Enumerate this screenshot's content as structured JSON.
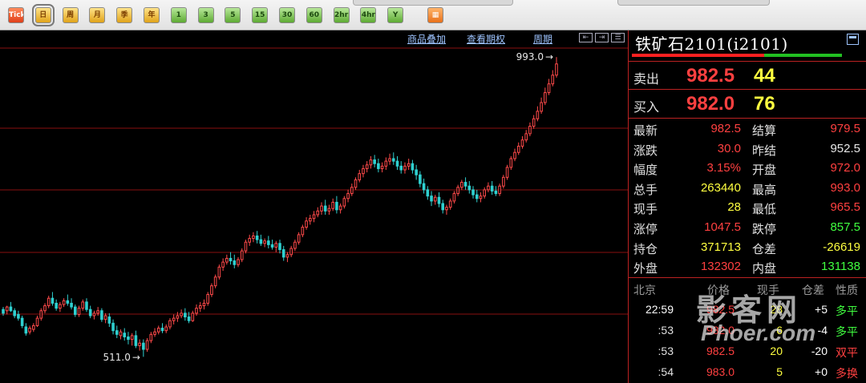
{
  "toolbar": {
    "buttons": [
      {
        "name": "tick",
        "label": "Tick",
        "color": "red"
      },
      {
        "name": "day",
        "label": "日",
        "color": "yellow",
        "selected": true
      },
      {
        "name": "week",
        "label": "周",
        "color": "yellow"
      },
      {
        "name": "month",
        "label": "月",
        "color": "yellow"
      },
      {
        "name": "season",
        "label": "季",
        "color": "yellow"
      },
      {
        "name": "year",
        "label": "年",
        "color": "yellow"
      },
      {
        "name": "min1",
        "label": "1",
        "color": "green"
      },
      {
        "name": "min3",
        "label": "3",
        "color": "green"
      },
      {
        "name": "min5",
        "label": "5",
        "color": "green"
      },
      {
        "name": "min15",
        "label": "15",
        "color": "green"
      },
      {
        "name": "min30",
        "label": "30",
        "color": "green"
      },
      {
        "name": "min60",
        "label": "60",
        "color": "green"
      },
      {
        "name": "hour2",
        "label": "2hr",
        "color": "green"
      },
      {
        "name": "hour4",
        "label": "4hr",
        "color": "green"
      },
      {
        "name": "custom",
        "label": "Y",
        "color": "green"
      },
      {
        "name": "grid",
        "label": "▦",
        "color": "orange"
      }
    ]
  },
  "chart_header": {
    "overlay_link": "商品叠加",
    "options_link": "查看期权",
    "period_link": "周期"
  },
  "chart_annotations": {
    "high_label": "993.0",
    "low_label": "511.0"
  },
  "colors": {
    "up": "#ff4a4a",
    "down": "#2fd0d0",
    "grid": "#8a1010",
    "accent_red": "#ff4040",
    "accent_yellow": "#ffff40",
    "accent_green": "#40ff40"
  },
  "chart_data": {
    "type": "candlestick",
    "high_marker": 993.0,
    "low_marker": 511.0,
    "ylim": [
      470,
      1010
    ],
    "candles": [
      [
        588,
        592,
        582,
        578
      ],
      [
        586,
        594,
        592,
        580
      ],
      [
        592,
        600,
        586,
        584
      ],
      [
        586,
        590,
        578,
        574
      ],
      [
        580,
        586,
        574,
        570
      ],
      [
        574,
        578,
        562,
        558
      ],
      [
        560,
        566,
        550,
        546
      ],
      [
        552,
        562,
        558,
        548
      ],
      [
        556,
        566,
        562,
        552
      ],
      [
        562,
        578,
        574,
        560
      ],
      [
        574,
        590,
        586,
        570
      ],
      [
        586,
        598,
        594,
        582
      ],
      [
        594,
        610,
        606,
        590
      ],
      [
        606,
        616,
        598,
        594
      ],
      [
        598,
        604,
        590,
        586
      ],
      [
        590,
        600,
        596,
        584
      ],
      [
        596,
        606,
        602,
        592
      ],
      [
        602,
        612,
        598,
        594
      ],
      [
        598,
        606,
        592,
        588
      ],
      [
        592,
        596,
        580,
        576
      ],
      [
        580,
        594,
        590,
        576
      ],
      [
        590,
        604,
        600,
        586
      ],
      [
        600,
        606,
        588,
        584
      ],
      [
        588,
        594,
        578,
        574
      ],
      [
        578,
        586,
        582,
        572
      ],
      [
        582,
        592,
        586,
        578
      ],
      [
        586,
        590,
        572,
        568
      ],
      [
        572,
        582,
        578,
        566
      ],
      [
        576,
        582,
        566,
        560
      ],
      [
        566,
        572,
        554,
        548
      ],
      [
        554,
        562,
        548,
        542
      ],
      [
        546,
        556,
        552,
        540
      ],
      [
        550,
        558,
        544,
        538
      ],
      [
        544,
        552,
        540,
        532
      ],
      [
        540,
        550,
        546,
        530
      ],
      [
        546,
        554,
        530,
        526
      ],
      [
        530,
        540,
        534,
        522
      ],
      [
        534,
        540,
        524,
        512
      ],
      [
        524,
        542,
        538,
        520
      ],
      [
        538,
        552,
        548,
        534
      ],
      [
        548,
        558,
        552,
        544
      ],
      [
        552,
        562,
        558,
        548
      ],
      [
        558,
        566,
        554,
        550
      ],
      [
        554,
        564,
        560,
        550
      ],
      [
        560,
        574,
        570,
        556
      ],
      [
        570,
        580,
        574,
        564
      ],
      [
        574,
        584,
        578,
        568
      ],
      [
        578,
        588,
        582,
        574
      ],
      [
        582,
        590,
        576,
        570
      ],
      [
        576,
        584,
        570,
        566
      ],
      [
        570,
        586,
        582,
        568
      ],
      [
        582,
        596,
        590,
        578
      ],
      [
        590,
        600,
        594,
        584
      ],
      [
        594,
        604,
        598,
        588
      ],
      [
        598,
        616,
        612,
        594
      ],
      [
        612,
        630,
        626,
        608
      ],
      [
        626,
        644,
        640,
        622
      ],
      [
        640,
        660,
        656,
        636
      ],
      [
        656,
        670,
        664,
        650
      ],
      [
        664,
        676,
        670,
        660
      ],
      [
        670,
        680,
        666,
        660
      ],
      [
        666,
        676,
        660,
        654
      ],
      [
        660,
        672,
        668,
        656
      ],
      [
        668,
        686,
        682,
        664
      ],
      [
        682,
        700,
        696,
        678
      ],
      [
        696,
        708,
        702,
        690
      ],
      [
        702,
        712,
        706,
        696
      ],
      [
        706,
        714,
        700,
        694
      ],
      [
        700,
        708,
        694,
        690
      ],
      [
        694,
        702,
        698,
        688
      ],
      [
        698,
        706,
        692,
        686
      ],
      [
        692,
        700,
        688,
        684
      ],
      [
        688,
        698,
        694,
        680
      ],
      [
        694,
        700,
        684,
        678
      ],
      [
        684,
        690,
        672,
        666
      ],
      [
        672,
        680,
        676,
        664
      ],
      [
        676,
        690,
        686,
        672
      ],
      [
        686,
        700,
        696,
        682
      ],
      [
        696,
        712,
        708,
        692
      ],
      [
        708,
        724,
        720,
        704
      ],
      [
        720,
        736,
        730,
        716
      ],
      [
        730,
        740,
        734,
        724
      ],
      [
        734,
        746,
        740,
        728
      ],
      [
        740,
        752,
        746,
        736
      ],
      [
        746,
        760,
        754,
        740
      ],
      [
        754,
        764,
        746,
        740
      ],
      [
        746,
        756,
        750,
        740
      ],
      [
        750,
        766,
        760,
        746
      ],
      [
        760,
        770,
        748,
        742
      ],
      [
        748,
        758,
        754,
        742
      ],
      [
        754,
        770,
        766,
        750
      ],
      [
        766,
        780,
        774,
        760
      ],
      [
        774,
        790,
        784,
        770
      ],
      [
        784,
        800,
        796,
        780
      ],
      [
        796,
        812,
        806,
        792
      ],
      [
        806,
        820,
        814,
        800
      ],
      [
        814,
        826,
        820,
        808
      ],
      [
        820,
        834,
        828,
        814
      ],
      [
        828,
        836,
        822,
        816
      ],
      [
        822,
        830,
        814,
        808
      ],
      [
        814,
        824,
        818,
        808
      ],
      [
        818,
        832,
        826,
        812
      ],
      [
        826,
        838,
        830,
        820
      ],
      [
        830,
        840,
        826,
        820
      ],
      [
        826,
        834,
        818,
        812
      ],
      [
        818,
        826,
        812,
        806
      ],
      [
        812,
        824,
        818,
        806
      ],
      [
        818,
        830,
        822,
        812
      ],
      [
        822,
        828,
        812,
        806
      ],
      [
        812,
        820,
        804,
        796
      ],
      [
        804,
        810,
        790,
        784
      ],
      [
        790,
        798,
        780,
        774
      ],
      [
        780,
        786,
        770,
        764
      ],
      [
        770,
        778,
        762,
        754
      ],
      [
        762,
        772,
        768,
        756
      ],
      [
        768,
        776,
        758,
        752
      ],
      [
        758,
        764,
        748,
        742
      ],
      [
        748,
        756,
        752,
        740
      ],
      [
        752,
        766,
        762,
        748
      ],
      [
        762,
        778,
        774,
        758
      ],
      [
        774,
        788,
        784,
        770
      ],
      [
        784,
        796,
        792,
        780
      ],
      [
        792,
        800,
        786,
        780
      ],
      [
        786,
        794,
        780,
        774
      ],
      [
        780,
        786,
        772,
        766
      ],
      [
        772,
        780,
        766,
        760
      ],
      [
        766,
        776,
        770,
        760
      ],
      [
        770,
        784,
        780,
        766
      ],
      [
        780,
        792,
        786,
        776
      ],
      [
        786,
        794,
        778,
        772
      ],
      [
        778,
        786,
        774,
        770
      ],
      [
        774,
        790,
        786,
        770
      ],
      [
        786,
        804,
        800,
        782
      ],
      [
        800,
        820,
        816,
        796
      ],
      [
        816,
        834,
        830,
        812
      ],
      [
        830,
        846,
        840,
        826
      ],
      [
        840,
        856,
        850,
        836
      ],
      [
        850,
        866,
        860,
        846
      ],
      [
        860,
        876,
        870,
        856
      ],
      [
        870,
        888,
        882,
        866
      ],
      [
        882,
        900,
        894,
        878
      ],
      [
        894,
        914,
        906,
        890
      ],
      [
        906,
        928,
        920,
        902
      ],
      [
        920,
        944,
        936,
        916
      ],
      [
        936,
        958,
        950,
        932
      ],
      [
        950,
        972,
        964,
        946
      ],
      [
        964,
        993,
        982,
        960
      ]
    ]
  },
  "panel": {
    "title": "铁矿石2101(i2101)",
    "ratio_sell_fraction": 0.63,
    "sell": {
      "label": "卖出",
      "price": "982.5",
      "volume": "44"
    },
    "buy": {
      "label": "买入",
      "price": "982.0",
      "volume": "76"
    },
    "stats": [
      {
        "l1": "最新",
        "v1": "982.5",
        "c1": "#ff4040",
        "l2": "结算",
        "v2": "979.5",
        "c2": "#ff4040"
      },
      {
        "l1": "涨跌",
        "v1": "30.0",
        "c1": "#ff4040",
        "l2": "昨结",
        "v2": "952.5",
        "c2": "#e8e8e8"
      },
      {
        "l1": "幅度",
        "v1": "3.15%",
        "c1": "#ff4040",
        "l2": "开盘",
        "v2": "972.0",
        "c2": "#ff4040"
      },
      {
        "l1": "总手",
        "v1": "263440",
        "c1": "#ffff40",
        "l2": "最高",
        "v2": "993.0",
        "c2": "#ff4040"
      },
      {
        "l1": "现手",
        "v1": "28",
        "c1": "#ffff40",
        "l2": "最低",
        "v2": "965.5",
        "c2": "#ff4040"
      },
      {
        "l1": "涨停",
        "v1": "1047.5",
        "c1": "#ff4040",
        "l2": "跌停",
        "v2": "857.5",
        "c2": "#40ff40"
      },
      {
        "l1": "持仓",
        "v1": "371713",
        "c1": "#ffff40",
        "l2": "仓差",
        "v2": "-26619",
        "c2": "#ffff40"
      },
      {
        "l1": "外盘",
        "v1": "132302",
        "c1": "#ff4040",
        "l2": "内盘",
        "v2": "131138",
        "c2": "#40ff40"
      }
    ],
    "ticks_header": {
      "time": "北京",
      "price": "价格",
      "vol": "现手",
      "oi": "仓差",
      "nature": "性质"
    },
    "ticks": [
      {
        "time": "22:59",
        "price": "982.5",
        "vol": "28",
        "oi": "+5",
        "nature": "多平",
        "nature_color": "#40ff40",
        "time_color": "#ffffff"
      },
      {
        "time": ":53",
        "price": "982.0",
        "vol": "6",
        "oi": "-4",
        "nature": "多平",
        "nature_color": "#40ff40",
        "time_color": "#e0e0e0"
      },
      {
        "time": ":53",
        "price": "982.5",
        "vol": "20",
        "oi": "-20",
        "nature": "双平",
        "nature_color": "#ff4040",
        "time_color": "#e0e0e0"
      },
      {
        "time": ":54",
        "price": "983.0",
        "vol": "5",
        "oi": "+0",
        "nature": "多换",
        "nature_color": "#ff4040",
        "time_color": "#e0e0e0"
      }
    ]
  },
  "watermark": {
    "cn": "影客网",
    "en": "Phoer.com"
  }
}
